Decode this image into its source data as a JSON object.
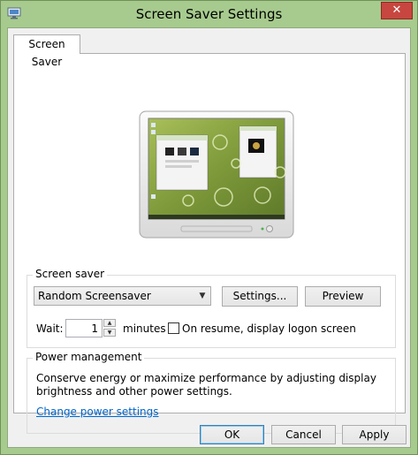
{
  "window": {
    "title": "Screen Saver Settings",
    "close_label": "✕"
  },
  "tabs": [
    {
      "label": "Screen Saver",
      "active": true
    }
  ],
  "screen_saver": {
    "group_label": "Screen saver",
    "selected": "Random Screensaver",
    "settings_button": "Settings...",
    "preview_button": "Preview",
    "wait_label": "Wait:",
    "wait_value": "1",
    "minutes_label": "minutes",
    "resume_label": "On resume, display logon screen",
    "resume_checked": false
  },
  "power": {
    "group_label": "Power management",
    "description_line1": "Conserve energy or maximize performance by adjusting display",
    "description_line2": "brightness and other power settings.",
    "link": "Change power settings"
  },
  "footer": {
    "ok": "OK",
    "cancel": "Cancel",
    "apply": "Apply"
  },
  "colors": {
    "frame": "#a7cb8e",
    "accent_close": "#c7463f",
    "link": "#0066cc"
  }
}
